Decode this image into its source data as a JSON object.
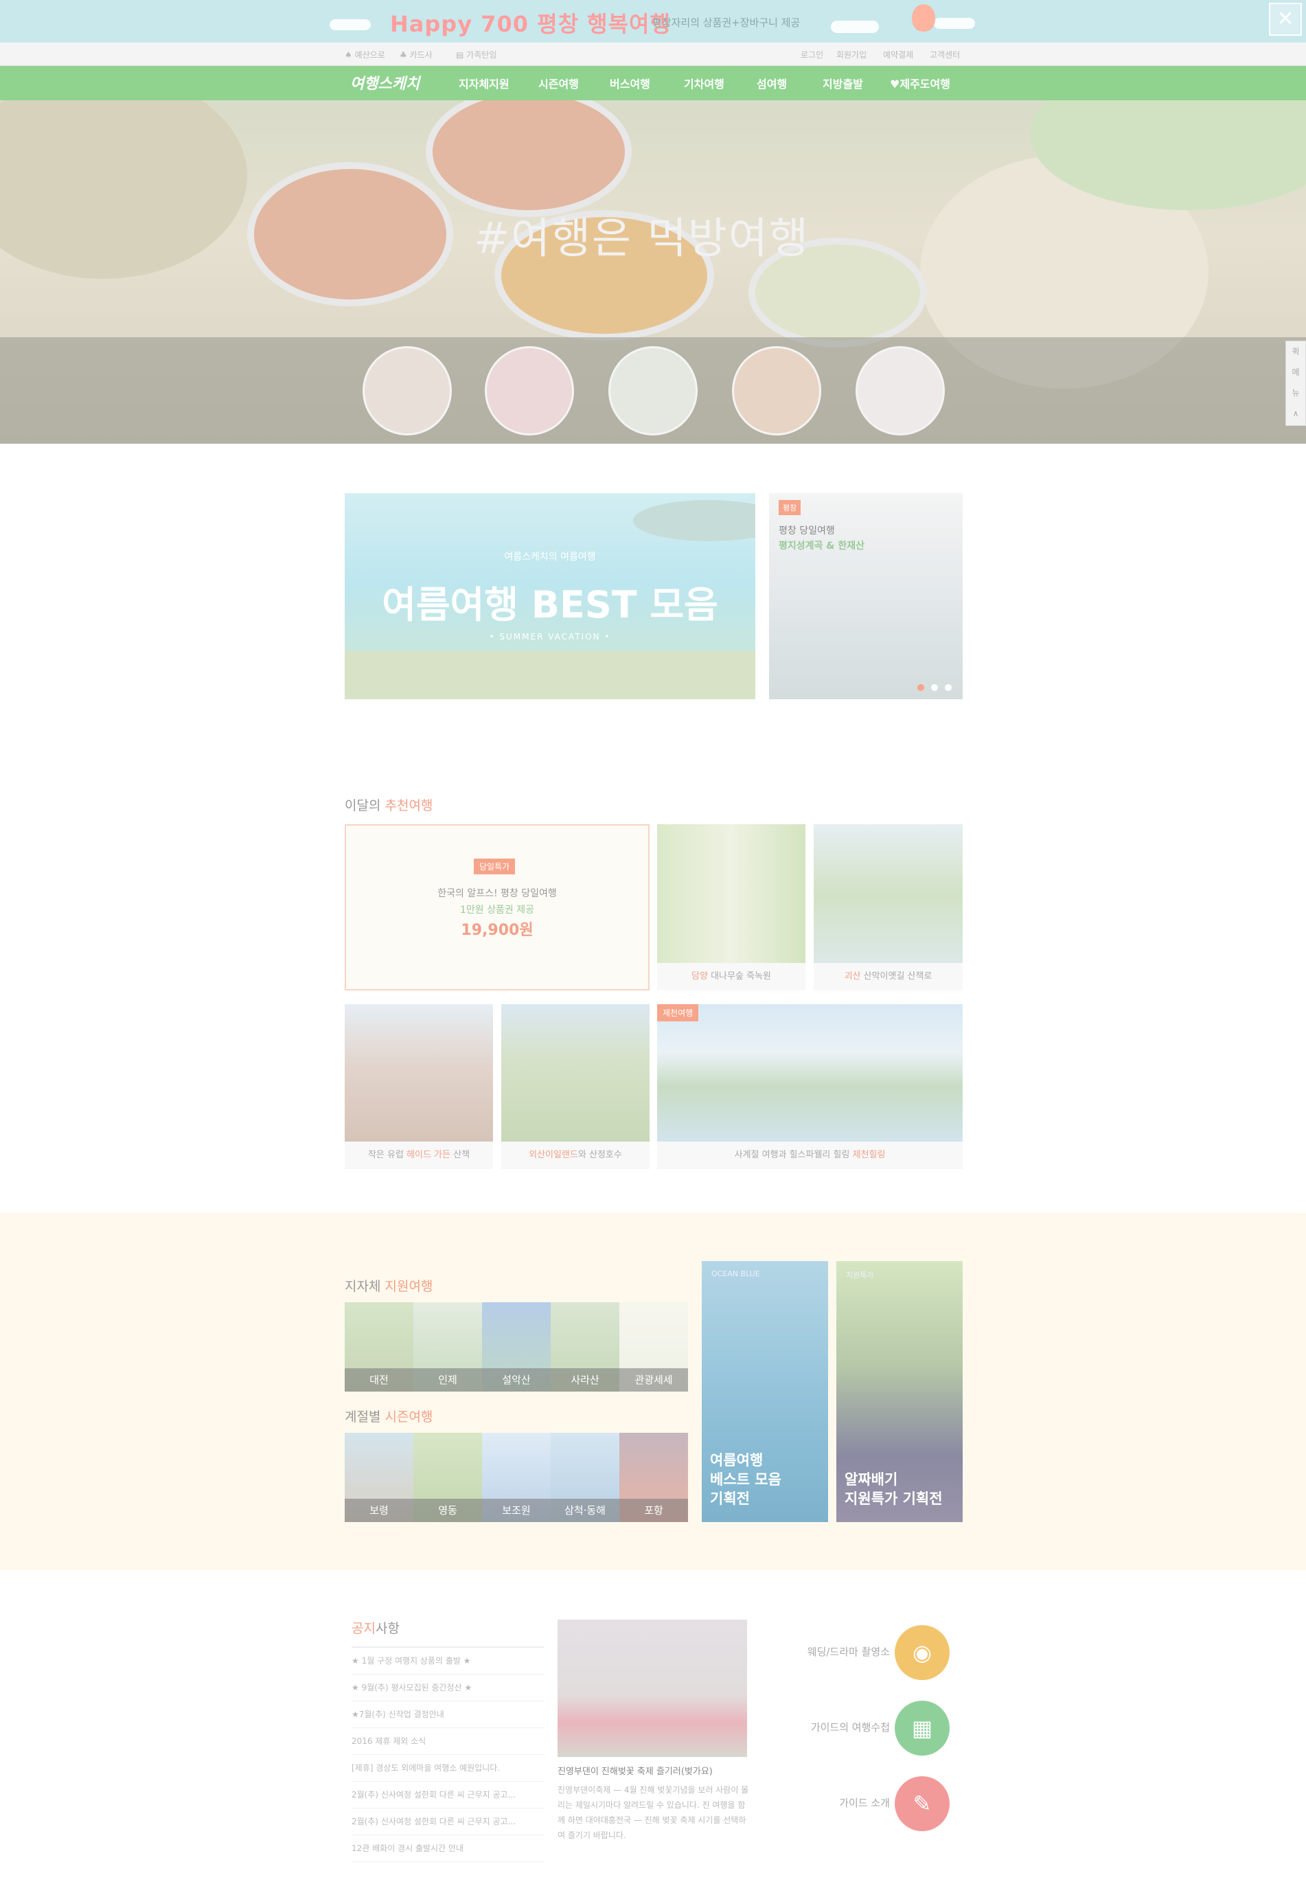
{
  "top_banner": {
    "headline": "Happy 700 평창 행복여행",
    "sub": "평창자리의 상품권+장바구니 제공",
    "close_glyph": "✕"
  },
  "util_bar": {
    "left": [
      "♠ 예산으로",
      "♣ 카드사",
      "▤ 가족탄임"
    ],
    "right": [
      "로그인",
      "회원가입",
      "예약결제",
      "고객센터"
    ]
  },
  "nav": {
    "logo": "여행스케치",
    "items": [
      "지자체지원",
      "시즌여행",
      "버스여행",
      "기차여행",
      "섬여행",
      "지방출발",
      "♥제주도여행"
    ]
  },
  "hero": {
    "title": "#여행은 먹방여행"
  },
  "side_quick": [
    "퀵",
    "메",
    "뉴",
    "∧"
  ],
  "promo_main": {
    "small": "여름스케치의 여름여행",
    "big": "여름여행 BEST 모음",
    "sub": "• SUMMER VACATION •"
  },
  "promo_side": {
    "badge": "평창",
    "line1": "평창 당일여행",
    "line2": "평지성계곡 & 한재산"
  },
  "recommend": {
    "title_pre": "이달의 ",
    "title_hl": "추천여행",
    "feature": {
      "badge": "당일특가",
      "line1": "한국의 알프스! 평창 당일여행",
      "line2": "1만원 상품권 제공",
      "price": "19,900원"
    },
    "cards": [
      {
        "hl": "담양",
        "rest": " 대나무숲 죽녹원"
      },
      {
        "hl": "괴산",
        "rest": " 산막이옛길 산책로"
      },
      {
        "pre": "작은 유럽 ",
        "hl": "헤이드 가든",
        "rest": " 산책"
      },
      {
        "hl": "외산이일랜드",
        "rest": "와 산정호수"
      },
      {
        "badge": "제천여행",
        "pre": "사계절 여행과 ",
        "rest": "힐스파웰리 힐링 ",
        "hl": "제천힐링"
      }
    ]
  },
  "local": {
    "title_pre": "지자체 ",
    "title_hl": "지원여행",
    "tiles": [
      "대전",
      "인제",
      "설악산",
      "사라산",
      "관광세세"
    ]
  },
  "season": {
    "title_pre": "계절별 ",
    "title_hl": "시즌여행",
    "tiles": [
      "보령",
      "영동",
      "보조원",
      "삼척·동해",
      "포항"
    ]
  },
  "big_promos": [
    {
      "small": "OCEAN BLUE",
      "lines": [
        "여름여행",
        "베스트 모음",
        "기획전"
      ]
    },
    {
      "small": "지원특가",
      "lines": [
        "알짜배기",
        "지원특가 기획전"
      ]
    }
  ],
  "notice": {
    "title_hl": "공지",
    "title_rest": "사항",
    "items": [
      "★ 1월 구정 여행지 상품의 출발 ★",
      "★ 9월(추) 평사모집된 중간정산 ★",
      "★7월(추) 신작업 결정안내",
      "2016 제휴 제외 소식",
      "[제휴] 경상도 외에마을 여행소 예원입니다.",
      "2월(추) 신사여정 설한회 다른 씨 근무지 공고...",
      "2월(추) 신사여정 설한회 다른 씨 근무지 공고...",
      "12관 배화이 경시 출발시간 안내"
    ]
  },
  "news": {
    "headline": "진영부댄이 진해벚꽃 축제 즐기러(벚가요)",
    "body": "진영부댄이축제 — 4월 진해 벚꽃기념을 보러 사람이 몰리는 제일시기마다 알려드릴 수 있습니다. 진 여행을 함께 하면 대야대흥전국 — 진해 벚꽃 축제 시기를 선택하여 즐기기 바랍니다."
  },
  "services": [
    {
      "label": "웨딩/드라마 촬영소",
      "icon": "camera-icon",
      "glyph": "◉",
      "color": "#f2c56c"
    },
    {
      "label": "가이드의 여행수첩",
      "icon": "calendar-icon",
      "glyph": "▦",
      "color": "#8fd09a"
    },
    {
      "label": "가이드 소개",
      "icon": "guide-icon",
      "glyph": "✎",
      "color": "#f29a9a"
    }
  ]
}
